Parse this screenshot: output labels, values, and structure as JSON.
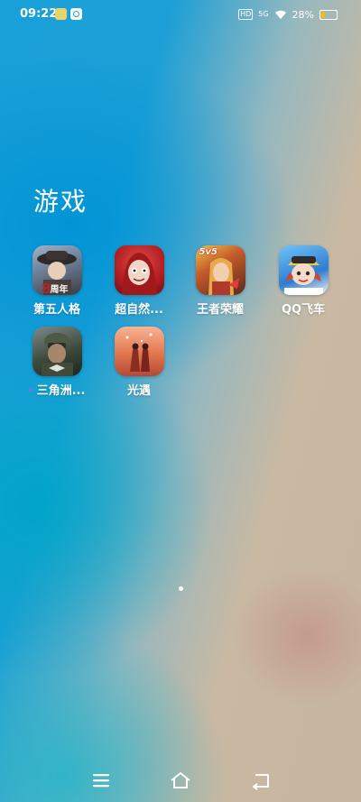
{
  "status_bar": {
    "time": "09:22",
    "battery_percent": "28%",
    "battery_level": 0.28,
    "network": "5G",
    "hd": "HD",
    "icons": [
      "notification-app-icon",
      "notification-app-icon-2",
      "hd-icon",
      "signal-icon",
      "wifi-icon",
      "battery-icon"
    ]
  },
  "folder": {
    "title": "游戏",
    "apps": [
      {
        "label": "第五人格",
        "icon": "identity-v-app-icon",
        "badge": "周年",
        "color": "#7b8ea6"
      },
      {
        "label": "超自然...",
        "icon": "supernatural-app-icon",
        "color": "#c0262b"
      },
      {
        "label": "王者荣耀",
        "icon": "honor-of-kings-app-icon",
        "badge": "5v5",
        "color": "#8a4b2a"
      },
      {
        "label": "QQ飞车",
        "icon": "qq-speed-app-icon",
        "color": "#2f7cd1"
      },
      {
        "label": "三角洲...",
        "icon": "delta-force-app-icon",
        "new_dot": true,
        "color": "#3d4a3a"
      },
      {
        "label": "光遇",
        "icon": "sky-app-icon",
        "color": "#d8704a"
      }
    ]
  },
  "page_indicator": {
    "current": 1,
    "total": 1
  },
  "nav_bar": {
    "icons": [
      "menu-icon",
      "home-icon",
      "back-icon"
    ]
  }
}
